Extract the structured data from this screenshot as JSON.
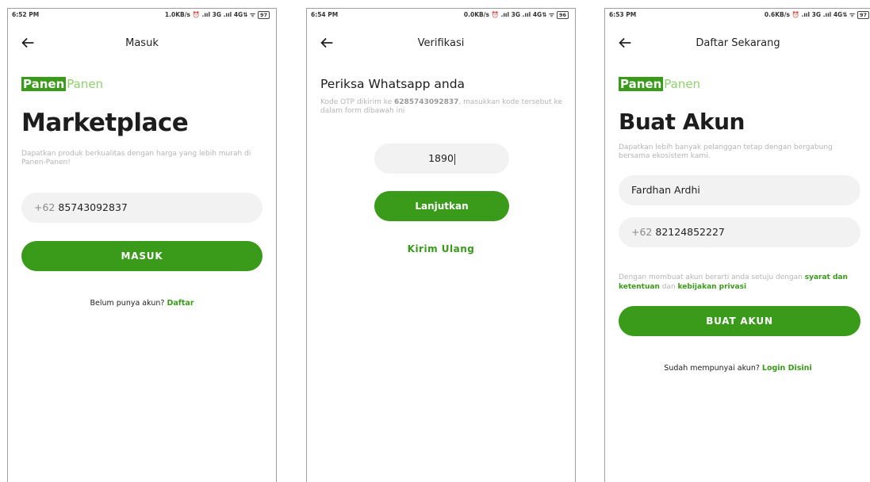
{
  "screens": [
    {
      "status": {
        "time": "6:52 PM",
        "right": "1.0KB/s ⏰ .ııl 3G .ııl 4G⇅ ᯤ",
        "battery": "97"
      },
      "title": "Masuk",
      "brand": {
        "part1": "Panen",
        "part2": "Panen"
      },
      "headline": "Marketplace",
      "description": "Dapatkan produk berkualitas dengan harga yang lebih murah di Panen-Panen!",
      "phone": {
        "prefix": "+62",
        "value": "85743092837"
      },
      "button": "MASUK",
      "footer": {
        "text": "Belum punya akun?",
        "link": "Daftar"
      }
    },
    {
      "status": {
        "time": "6:54 PM",
        "right": "0.0KB/s ⏰ .ııl 3G .ııl 4G⇅ ᯤ",
        "battery": "96"
      },
      "title": "Verifikasi",
      "heading": "Periksa Whatsapp anda",
      "desc_pre": "Kode OTP dikirim ke",
      "desc_number": "6285743092837",
      "desc_post": ", masukkan kode tersebut ke dalam form dibawah ini",
      "otp": "1890",
      "button": "Lanjutkan",
      "resend": "Kirim Ulang"
    },
    {
      "status": {
        "time": "6:53 PM",
        "right": "0.6KB/s ⏰ .ııl 3G .ııl 4G⇅ ᯤ",
        "battery": "97"
      },
      "title": "Daftar Sekarang",
      "brand": {
        "part1": "Panen",
        "part2": "Panen"
      },
      "headline": "Buat Akun",
      "description": "Dapatkan lebih banyak pelanggan tetap dengan bergabung bersama ekosistem kami.",
      "name_value": "Fardhan Ardhi",
      "phone": {
        "prefix": "+62",
        "value": "82124852227"
      },
      "terms": {
        "pre": "Dengan membuat akun berarti anda setuju dengan",
        "link1": "syarat dan ketentuan",
        "mid": "dan",
        "link2": "kebijakan privasi"
      },
      "button": "BUAT AKUN",
      "footer": {
        "text": "Sudah mempunyai akun?",
        "link": "Login Disini"
      }
    }
  ],
  "colors": {
    "accent": "#3a9a1a",
    "brand_light": "#8dd26d",
    "input_bg": "#f2f2f2",
    "muted_text": "#b5b5b5"
  },
  "icons": [
    "back-arrow-icon",
    "alarm-icon",
    "signal-icon",
    "wifi-icon",
    "battery-icon"
  ]
}
